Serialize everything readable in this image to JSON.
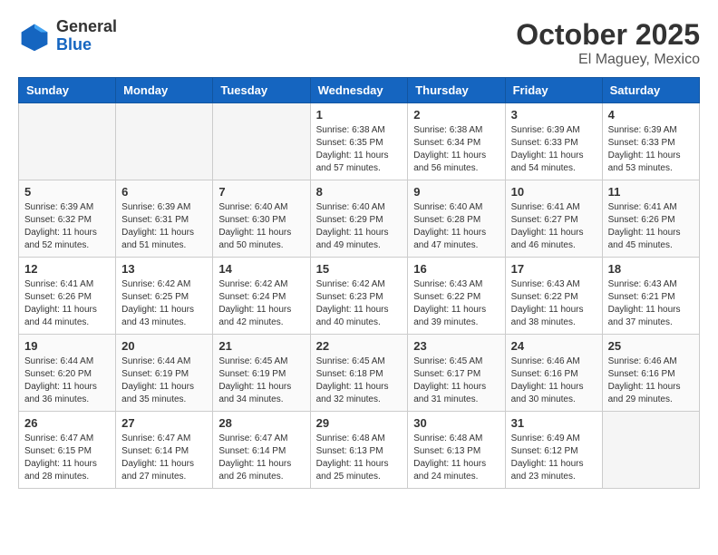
{
  "header": {
    "logo": {
      "general": "General",
      "blue": "Blue"
    },
    "month": "October 2025",
    "location": "El Maguey, Mexico"
  },
  "weekdays": [
    "Sunday",
    "Monday",
    "Tuesday",
    "Wednesday",
    "Thursday",
    "Friday",
    "Saturday"
  ],
  "weeks": [
    [
      {
        "day": "",
        "info": ""
      },
      {
        "day": "",
        "info": ""
      },
      {
        "day": "",
        "info": ""
      },
      {
        "day": "1",
        "info": "Sunrise: 6:38 AM\nSunset: 6:35 PM\nDaylight: 11 hours and 57 minutes."
      },
      {
        "day": "2",
        "info": "Sunrise: 6:38 AM\nSunset: 6:34 PM\nDaylight: 11 hours and 56 minutes."
      },
      {
        "day": "3",
        "info": "Sunrise: 6:39 AM\nSunset: 6:33 PM\nDaylight: 11 hours and 54 minutes."
      },
      {
        "day": "4",
        "info": "Sunrise: 6:39 AM\nSunset: 6:33 PM\nDaylight: 11 hours and 53 minutes."
      }
    ],
    [
      {
        "day": "5",
        "info": "Sunrise: 6:39 AM\nSunset: 6:32 PM\nDaylight: 11 hours and 52 minutes."
      },
      {
        "day": "6",
        "info": "Sunrise: 6:39 AM\nSunset: 6:31 PM\nDaylight: 11 hours and 51 minutes."
      },
      {
        "day": "7",
        "info": "Sunrise: 6:40 AM\nSunset: 6:30 PM\nDaylight: 11 hours and 50 minutes."
      },
      {
        "day": "8",
        "info": "Sunrise: 6:40 AM\nSunset: 6:29 PM\nDaylight: 11 hours and 49 minutes."
      },
      {
        "day": "9",
        "info": "Sunrise: 6:40 AM\nSunset: 6:28 PM\nDaylight: 11 hours and 47 minutes."
      },
      {
        "day": "10",
        "info": "Sunrise: 6:41 AM\nSunset: 6:27 PM\nDaylight: 11 hours and 46 minutes."
      },
      {
        "day": "11",
        "info": "Sunrise: 6:41 AM\nSunset: 6:26 PM\nDaylight: 11 hours and 45 minutes."
      }
    ],
    [
      {
        "day": "12",
        "info": "Sunrise: 6:41 AM\nSunset: 6:26 PM\nDaylight: 11 hours and 44 minutes."
      },
      {
        "day": "13",
        "info": "Sunrise: 6:42 AM\nSunset: 6:25 PM\nDaylight: 11 hours and 43 minutes."
      },
      {
        "day": "14",
        "info": "Sunrise: 6:42 AM\nSunset: 6:24 PM\nDaylight: 11 hours and 42 minutes."
      },
      {
        "day": "15",
        "info": "Sunrise: 6:42 AM\nSunset: 6:23 PM\nDaylight: 11 hours and 40 minutes."
      },
      {
        "day": "16",
        "info": "Sunrise: 6:43 AM\nSunset: 6:22 PM\nDaylight: 11 hours and 39 minutes."
      },
      {
        "day": "17",
        "info": "Sunrise: 6:43 AM\nSunset: 6:22 PM\nDaylight: 11 hours and 38 minutes."
      },
      {
        "day": "18",
        "info": "Sunrise: 6:43 AM\nSunset: 6:21 PM\nDaylight: 11 hours and 37 minutes."
      }
    ],
    [
      {
        "day": "19",
        "info": "Sunrise: 6:44 AM\nSunset: 6:20 PM\nDaylight: 11 hours and 36 minutes."
      },
      {
        "day": "20",
        "info": "Sunrise: 6:44 AM\nSunset: 6:19 PM\nDaylight: 11 hours and 35 minutes."
      },
      {
        "day": "21",
        "info": "Sunrise: 6:45 AM\nSunset: 6:19 PM\nDaylight: 11 hours and 34 minutes."
      },
      {
        "day": "22",
        "info": "Sunrise: 6:45 AM\nSunset: 6:18 PM\nDaylight: 11 hours and 32 minutes."
      },
      {
        "day": "23",
        "info": "Sunrise: 6:45 AM\nSunset: 6:17 PM\nDaylight: 11 hours and 31 minutes."
      },
      {
        "day": "24",
        "info": "Sunrise: 6:46 AM\nSunset: 6:16 PM\nDaylight: 11 hours and 30 minutes."
      },
      {
        "day": "25",
        "info": "Sunrise: 6:46 AM\nSunset: 6:16 PM\nDaylight: 11 hours and 29 minutes."
      }
    ],
    [
      {
        "day": "26",
        "info": "Sunrise: 6:47 AM\nSunset: 6:15 PM\nDaylight: 11 hours and 28 minutes."
      },
      {
        "day": "27",
        "info": "Sunrise: 6:47 AM\nSunset: 6:14 PM\nDaylight: 11 hours and 27 minutes."
      },
      {
        "day": "28",
        "info": "Sunrise: 6:47 AM\nSunset: 6:14 PM\nDaylight: 11 hours and 26 minutes."
      },
      {
        "day": "29",
        "info": "Sunrise: 6:48 AM\nSunset: 6:13 PM\nDaylight: 11 hours and 25 minutes."
      },
      {
        "day": "30",
        "info": "Sunrise: 6:48 AM\nSunset: 6:13 PM\nDaylight: 11 hours and 24 minutes."
      },
      {
        "day": "31",
        "info": "Sunrise: 6:49 AM\nSunset: 6:12 PM\nDaylight: 11 hours and 23 minutes."
      },
      {
        "day": "",
        "info": ""
      }
    ]
  ]
}
